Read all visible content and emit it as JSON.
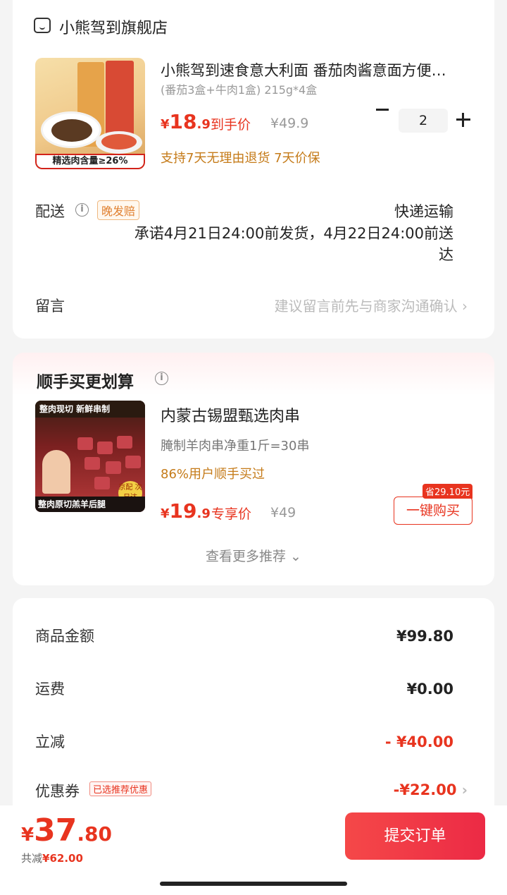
{
  "shop": {
    "name": "小熊驾到旗舰店"
  },
  "product": {
    "title": "小熊驾到速食意大利面  番茄肉酱意面方便…",
    "spec": "(番茄3盒+牛肉1盒)  215g*4盒",
    "image_band": "精选肉含量≥26%",
    "currency": "¥",
    "price_int": "18",
    "price_dec": ".9",
    "price_tag": "到手价",
    "original_price": "¥49.9",
    "quantity": "2",
    "guarantees": "支持7天无理由退货  7天价保"
  },
  "delivery": {
    "label": "配送",
    "badge": "晚发赔",
    "method": "快递运输",
    "promise": "承诺4月21日24:00前发货，4月22日24:00前送达"
  },
  "message": {
    "label": "留言",
    "hint": "建议留言前先与商家沟通确认"
  },
  "recommend": {
    "section_title": "顺手买更划算",
    "title": "内蒙古锡盟甄选肉串",
    "spec": "腌制羊肉串净重1斤=30串",
    "social": "86%用户顺手买过",
    "image_top": "整肉现切 新鲜串制",
    "image_bottom": "整肉原切羔羊后腿",
    "image_circle": "京配 次日达",
    "currency": "¥",
    "price_int": "19",
    "price_dec": ".9",
    "price_tag": "专享价",
    "original_price": "¥49",
    "save_badge": "省29.10元",
    "buy_label": "一键购买",
    "more_label": "查看更多推荐 ⌄"
  },
  "summary": {
    "rows": [
      {
        "label": "商品金额",
        "value": "¥99.80"
      },
      {
        "label": "运费",
        "value": "¥0.00"
      },
      {
        "label": "立减",
        "value": "- ¥40.00"
      },
      {
        "label": "优惠券",
        "value": "-¥22.00",
        "badge": "已选推荐优惠"
      }
    ]
  },
  "footer": {
    "currency": "¥",
    "total_int": "37",
    "total_dec": ".80",
    "saved_label": "共减",
    "saved_value": "¥62.00",
    "submit_label": "提交订单"
  },
  "colors": {
    "accent": "#e8341f",
    "orange": "#c57b19"
  }
}
